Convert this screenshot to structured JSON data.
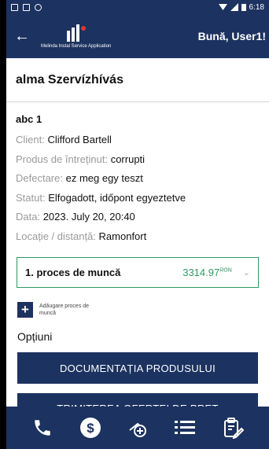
{
  "statusbar": {
    "time": "6:18"
  },
  "appbar": {
    "logo_caption": "Melinda Instal Service Application",
    "greeting": "Bună, User1!"
  },
  "page_title": "alma Szervízhívás",
  "details": {
    "case_id": "abc 1",
    "rows": [
      {
        "label": "Client:",
        "value": "Clifford Bartell"
      },
      {
        "label": "Produs de întreținut:",
        "value": "corrupti"
      },
      {
        "label": "Defectare:",
        "value": "ez meg egy teszt"
      },
      {
        "label": "Statut:",
        "value": "Elfogadott, időpont egyeztetve"
      },
      {
        "label": "Data:",
        "value": "2023. July 20, 20:40"
      },
      {
        "label": "Locație / distanță:",
        "value": "Ramonfort"
      }
    ]
  },
  "process": {
    "name": "1. proces de muncă",
    "amount": "3314.97",
    "currency": "RON"
  },
  "add_process_label": "Adăugare proces de muncă",
  "options_title": "Opțiuni",
  "options": {
    "documentation": "DOCUMENTAȚIA PRODUSULUI",
    "partial": "TRIMITEREA OFERTEI DE PREȚ"
  },
  "colors": {
    "primary": "#1c3260",
    "accent_green": "#2e9a63",
    "logo_dot": "#e0362b"
  },
  "bottom_nav_icons": [
    "phone-icon",
    "dollar-icon",
    "add-collection-icon",
    "list-icon",
    "clipboard-edit-icon"
  ]
}
